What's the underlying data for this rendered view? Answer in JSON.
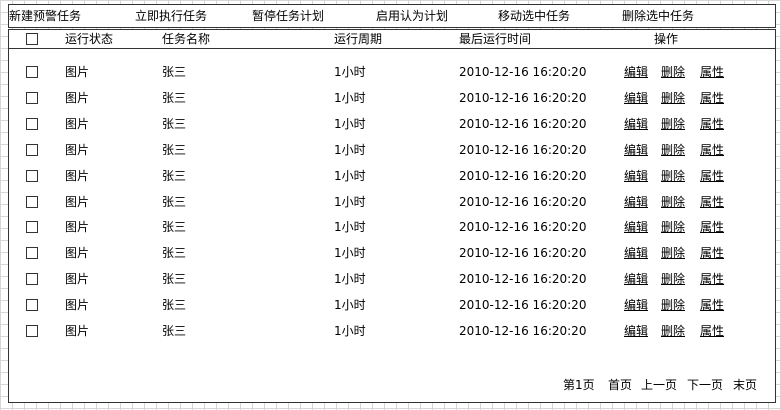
{
  "toolbar": {
    "new_alert_task": "新建预警任务",
    "run_now": "立即执行任务",
    "pause_plan": "暂停任务计划",
    "enable_default_plan": "启用认为计划",
    "move_selected": "移动选中任务",
    "delete_selected": "删除选中任务"
  },
  "table": {
    "columns": [
      "运行状态",
      "任务名称",
      "运行周期",
      "最后运行时间",
      "操作"
    ],
    "actions": {
      "edit": "编辑",
      "delete": "删除",
      "properties": "属性"
    },
    "rows": [
      {
        "status": "图片",
        "name": "张三",
        "period": "1小时",
        "last_run": "2010-12-16 16:20:20"
      },
      {
        "status": "图片",
        "name": "张三",
        "period": "1小时",
        "last_run": "2010-12-16 16:20:20"
      },
      {
        "status": "图片",
        "name": "张三",
        "period": "1小时",
        "last_run": "2010-12-16 16:20:20"
      },
      {
        "status": "图片",
        "name": "张三",
        "period": "1小时",
        "last_run": "2010-12-16 16:20:20"
      },
      {
        "status": "图片",
        "name": "张三",
        "period": "1小时",
        "last_run": "2010-12-16 16:20:20"
      },
      {
        "status": "图片",
        "name": "张三",
        "period": "1小时",
        "last_run": "2010-12-16 16:20:20"
      },
      {
        "status": "图片",
        "name": "张三",
        "period": "1小时",
        "last_run": "2010-12-16 16:20:20"
      },
      {
        "status": "图片",
        "name": "张三",
        "period": "1小时",
        "last_run": "2010-12-16 16:20:20"
      },
      {
        "status": "图片",
        "name": "张三",
        "period": "1小时",
        "last_run": "2010-12-16 16:20:20"
      },
      {
        "status": "图片",
        "name": "张三",
        "period": "1小时",
        "last_run": "2010-12-16 16:20:20"
      },
      {
        "status": "图片",
        "name": "张三",
        "period": "1小时",
        "last_run": "2010-12-16 16:20:20"
      }
    ]
  },
  "pagination": {
    "current": "第1页",
    "first": "首页",
    "prev": "上一页",
    "next": "下一页",
    "last": "末页"
  }
}
